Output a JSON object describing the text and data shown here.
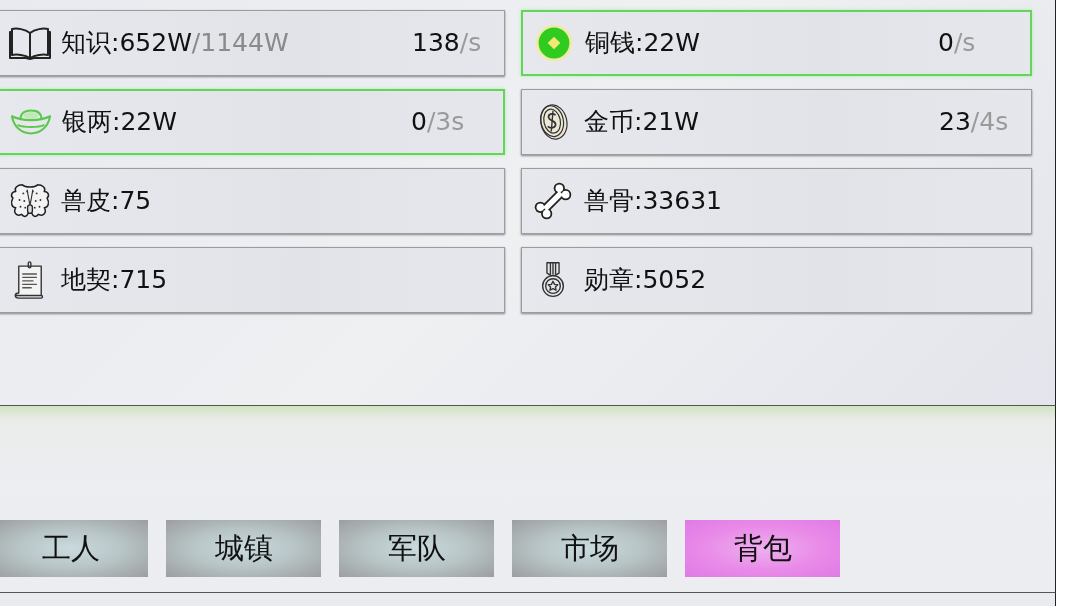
{
  "resources": [
    {
      "kind": "book",
      "label": "知识:652W",
      "limit": "/1144W",
      "rate": "138",
      "rate_unit": "/s",
      "highlighted": false
    },
    {
      "kind": "copper-coin",
      "label": "铜钱:22W",
      "rate": "0",
      "rate_unit": "/s",
      "highlighted": true
    },
    {
      "kind": "silver-ingot",
      "label": "银两:22W",
      "rate": "0",
      "rate_unit": "/3s",
      "highlighted": true
    },
    {
      "kind": "gold-coin",
      "label": "金币:21W",
      "rate": "23",
      "rate_unit": "/4s",
      "highlighted": false
    },
    {
      "kind": "pelt",
      "label": "兽皮:75",
      "highlighted": false
    },
    {
      "kind": "bone",
      "label": "兽骨:33631",
      "highlighted": false
    },
    {
      "kind": "scroll",
      "label": "地契:715",
      "highlighted": false
    },
    {
      "kind": "medal",
      "label": "勋章:5052",
      "highlighted": false
    }
  ],
  "tabs": [
    {
      "label": "工人",
      "selected": false
    },
    {
      "label": "城镇",
      "selected": false
    },
    {
      "label": "军队",
      "selected": false
    },
    {
      "label": "市场",
      "selected": false
    },
    {
      "label": "背包",
      "selected": true
    }
  ]
}
